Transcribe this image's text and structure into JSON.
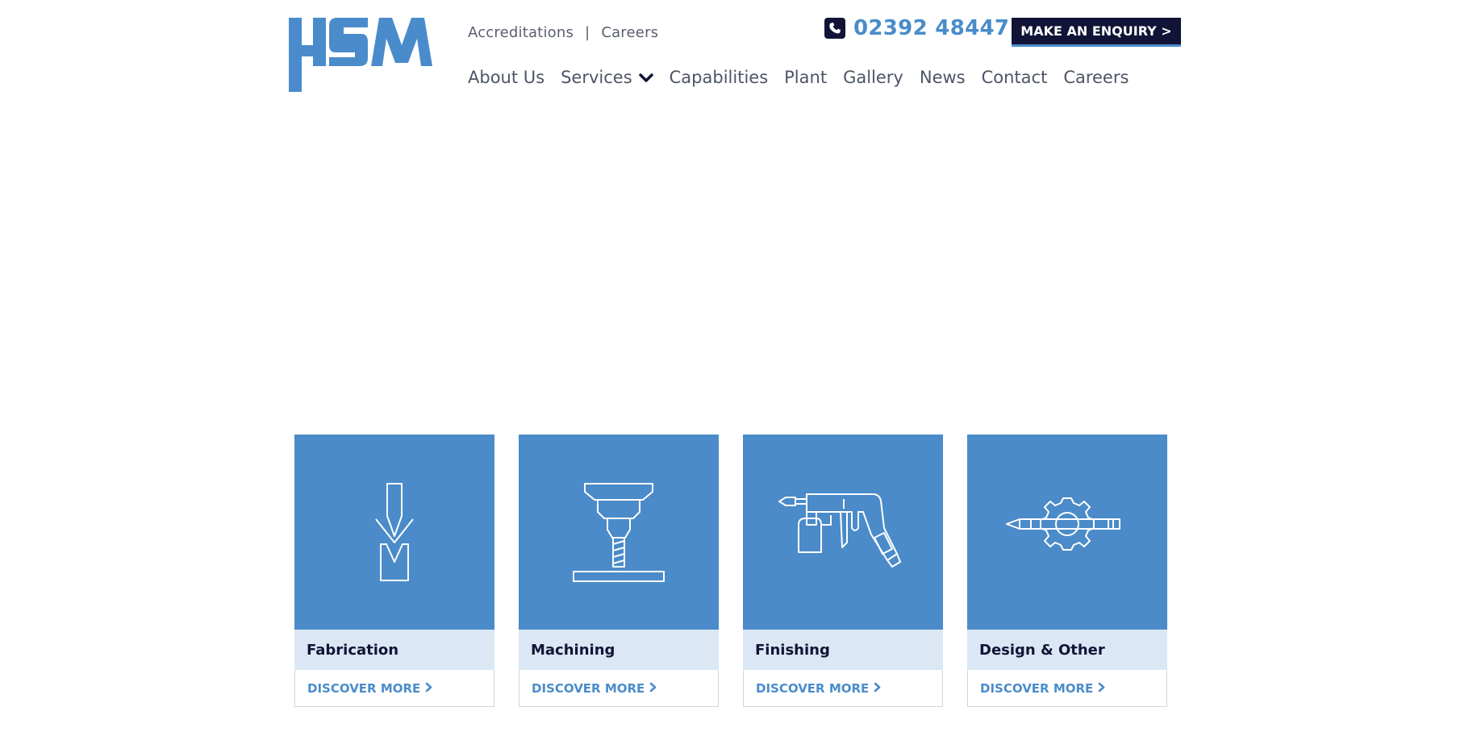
{
  "brand": {
    "logo_text": "HSM",
    "color": "#4a8ccb",
    "dark": "#111436"
  },
  "toplinks": {
    "accreditations": "Accreditations",
    "separator": "|",
    "careers": "Careers"
  },
  "contact": {
    "phone_icon": "phone-icon",
    "phone": "02392 484471",
    "enquiry_label": "MAKE AN ENQUIRY >"
  },
  "nav": {
    "items": [
      {
        "label": "About Us"
      },
      {
        "label": "Services",
        "has_dropdown": true
      },
      {
        "label": "Capabilities"
      },
      {
        "label": "Plant"
      },
      {
        "label": "Gallery"
      },
      {
        "label": "News"
      },
      {
        "label": "Contact"
      },
      {
        "label": "Careers"
      }
    ]
  },
  "services": [
    {
      "title": "Fabrication",
      "icon": "press-brake-icon",
      "cta": "DISCOVER MORE"
    },
    {
      "title": "Machining",
      "icon": "milling-machine-icon",
      "cta": "DISCOVER MORE"
    },
    {
      "title": "Finishing",
      "icon": "spray-gun-icon",
      "cta": "DISCOVER MORE"
    },
    {
      "title": "Design & Other",
      "icon": "design-gear-pencil-icon",
      "cta": "DISCOVER MORE"
    }
  ]
}
